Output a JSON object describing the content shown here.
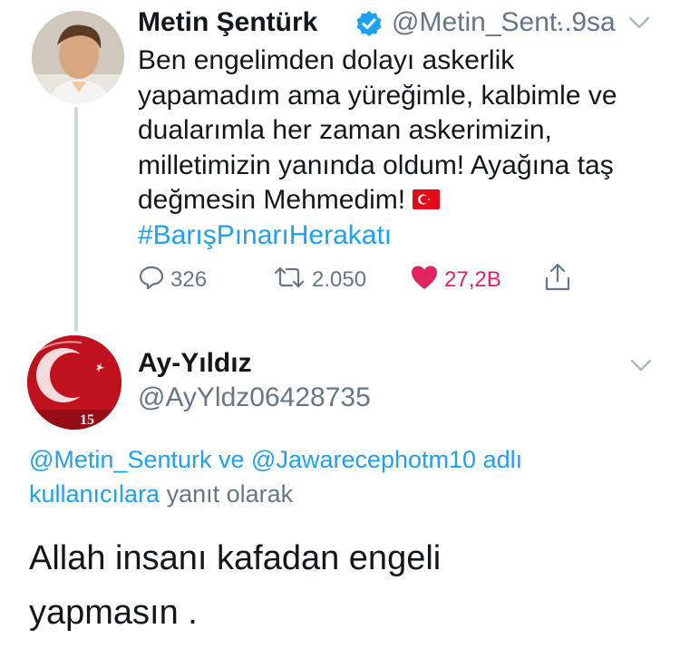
{
  "colors": {
    "link": "#1da1f2",
    "muted": "#657786",
    "like": "#e0245e",
    "verified": "#1da1f2"
  },
  "tweet": {
    "avatar_icon": "profile-photo-icon",
    "name": "Metin Şentürk",
    "verified_icon": "verified-badge-icon",
    "handle": "@Metin_Sent...",
    "time": "· 9sa",
    "body_lines": [
      "Ben engelimden dolayı askerlik",
      "yapamadım ama yüreğimle, kalbimle ve",
      "dualarımla her zaman askerimizin,",
      "milletimizin yanında oldum! Ayağına taş",
      "değmesin Mehmedim!"
    ],
    "flag_icon": "turkey-flag-icon",
    "hashtag": "#BarışPınarıHerakatı",
    "actions": {
      "reply_count": "326",
      "retweet_count": "2.050",
      "like_count": "27,2B"
    }
  },
  "reply": {
    "avatar_icon": "ay-yildiz-avatar-icon",
    "avatar_text": "15",
    "name": "Ay-Yıldız",
    "handle": "@AyYldz06428735",
    "replying_mentions": "@Metin_Senturk ve @Jawarecephotm10 adlı",
    "replying_mention_1": "@Metin_Senturk",
    "replying_and": " ve ",
    "replying_mention_2": "@Jawarecephotm10 adlı",
    "replying_line2_link": "kullanıcılara",
    "replying_line2_rest": " yanıt olarak",
    "body_lines": [
      "Allah insanı kafadan engeli",
      "yapmasın ."
    ]
  }
}
